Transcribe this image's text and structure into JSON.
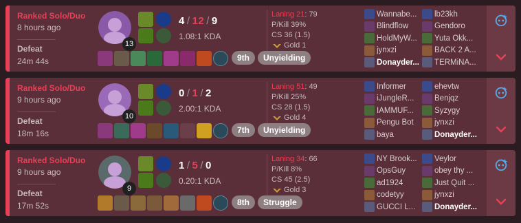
{
  "matches": [
    {
      "queue": "Ranked Solo/Duo",
      "time_ago": "8 hours ago",
      "result": "Defeat",
      "duration": "24m 44s",
      "champion_level": "13",
      "kills": "4",
      "deaths": "12",
      "assists": "9",
      "kda": "1.08:1 KDA",
      "placement": "9th",
      "tag": "Unyielding",
      "laning_label": "Laning 21",
      "laning_value": ": 79",
      "pkill": "P/Kill 39%",
      "cs": "CS 36 (1.5)",
      "rank": "Gold 1",
      "team1": [
        "Wannabe...",
        "Blindflow",
        "HoldMyW...",
        "jynxzi",
        "Donayder..."
      ],
      "team2": [
        "lb23kh",
        "Gendoro",
        "Yuta Okk...",
        "BACK 2 A...",
        "TERMiNA..."
      ],
      "me_team": 1,
      "me_index": 4
    },
    {
      "queue": "Ranked Solo/Duo",
      "time_ago": "9 hours ago",
      "result": "Defeat",
      "duration": "18m 16s",
      "champion_level": "10",
      "kills": "0",
      "deaths": "1",
      "assists": "2",
      "kda": "2.00:1 KDA",
      "placement": "7th",
      "tag": "Unyielding",
      "laning_label": "Laning 51",
      "laning_value": ": 49",
      "pkill": "P/Kill 25%",
      "cs": "CS 28 (1.5)",
      "rank": "Gold 4",
      "team1": [
        "Informer",
        "iJungleR...",
        "IAMMUF...",
        "Pengu Bot",
        "baya"
      ],
      "team2": [
        "ehevtw",
        "Benjqz",
        "Syzygy",
        "jynxzi",
        "Donayder..."
      ],
      "me_team": 2,
      "me_index": 4
    },
    {
      "queue": "Ranked Solo/Duo",
      "time_ago": "9 hours ago",
      "result": "Defeat",
      "duration": "17m 52s",
      "champion_level": "9",
      "kills": "1",
      "deaths": "5",
      "assists": "0",
      "kda": "0.20:1 KDA",
      "placement": "8th",
      "tag": "Struggle",
      "laning_label": "Laning 34",
      "laning_value": ": 66",
      "pkill": "P/Kill 8%",
      "cs": "CS 45 (2.5)",
      "rank": "Gold 3",
      "team1": [
        "NY Brook...",
        "OpsGuy",
        "ad1924",
        "codetyy",
        "GUCCI L..."
      ],
      "team2": [
        "Veylor",
        "obey thy ...",
        "Just Quit ...",
        "jynxzi",
        "Donayder..."
      ],
      "me_team": 2,
      "me_index": 4
    }
  ],
  "colors": {
    "loss_red": "#e84057",
    "card_bg": "#5a2f39",
    "badge_bg": "#8e7f83",
    "ai_icon": "#5aa9e6"
  },
  "icons": [
    "champion-portrait-icon",
    "summoner-spell-icon",
    "rune-icon",
    "item-icon",
    "ward-icon",
    "rank-emblem-icon",
    "ai-assistant-icon",
    "chevron-down-icon"
  ]
}
